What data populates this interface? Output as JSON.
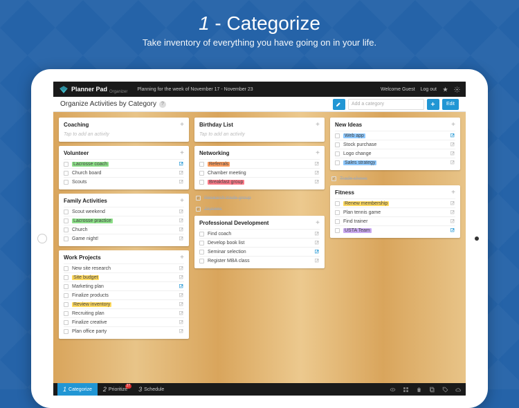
{
  "hero": {
    "number": "1",
    "title": "Categorize",
    "subtitle": "Take inventory of everything you have going on in your life."
  },
  "header": {
    "brand": "Planner Pad",
    "brand_sub": "Organizer",
    "week_label": "Planning for the week of November 17 - November 23",
    "welcome": "Welcome Guest",
    "logout": "Log out"
  },
  "titlebar": {
    "title": "Organize Activities by Category",
    "add_placeholder": "Add a category",
    "edit_label": "Edit"
  },
  "columns": [
    [
      {
        "title": "Coaching",
        "placeholder": "Tap to add an activity",
        "rows": []
      },
      {
        "title": "Volunteer",
        "rows": [
          {
            "label": "Lacrosse coach",
            "hl": "g",
            "ext": "blue"
          },
          {
            "label": "Church board",
            "ext": "gray"
          },
          {
            "label": "Scouts",
            "ext": "gray"
          }
        ]
      },
      {
        "title": "Family Activities",
        "rows": [
          {
            "label": "Scout weekend",
            "ext": "gray"
          },
          {
            "label": "Lacrosse practice",
            "hl": "g",
            "ext": "gray"
          },
          {
            "label": "Church",
            "ext": "gray"
          },
          {
            "label": "Game night!",
            "ext": "gray"
          }
        ]
      },
      {
        "title": "Work Projects",
        "rows": [
          {
            "label": "New site research",
            "ext": "gray"
          },
          {
            "label": "Site budget",
            "hl": "y",
            "ext": "gray"
          },
          {
            "label": "Marketing plan",
            "ext": "blue"
          },
          {
            "label": "Finalize products",
            "ext": "gray"
          },
          {
            "label": "Review inventory",
            "hl": "y",
            "ext": "gray"
          },
          {
            "label": "Recruiting plan",
            "ext": "gray"
          },
          {
            "label": "Finalize creative",
            "ext": "gray"
          },
          {
            "label": "Plan office party",
            "ext": "gray"
          }
        ]
      }
    ],
    [
      {
        "title": "Birthday List",
        "placeholder": "Tap to add an activity",
        "rows": []
      },
      {
        "title": "Networking",
        "rows": [
          {
            "label": "Referrals",
            "hl": "o",
            "ext": "gray"
          },
          {
            "label": "Chamber meeting",
            "ext": "gray"
          },
          {
            "label": "Breakfast group",
            "hl": "r",
            "ext": "gray"
          }
        ],
        "extras": [
          {
            "label": "Research trade group",
            "done": true
          },
          {
            "label": "Jaycees",
            "done": true
          }
        ]
      },
      {
        "title": "Professional Development",
        "rows": [
          {
            "label": "Find coach",
            "ext": "gray"
          },
          {
            "label": "Develop book list",
            "ext": "gray"
          },
          {
            "label": "Seminar selection",
            "ext": "blue"
          },
          {
            "label": "Register MBA class",
            "ext": "gray"
          }
        ]
      }
    ],
    [
      {
        "title": "New Ideas",
        "rows": [
          {
            "label": "Web app",
            "hl": "b",
            "ext": "blue"
          },
          {
            "label": "Stock purchase",
            "ext": "gray"
          },
          {
            "label": "Logo change",
            "ext": "gray"
          },
          {
            "label": "Sales strategy",
            "hl": "b",
            "ext": "gray"
          }
        ],
        "extras": [
          {
            "label": "Trade shows",
            "done": true
          }
        ]
      },
      {
        "title": "Fitness",
        "rows": [
          {
            "label": "Renew membership",
            "hl": "y",
            "ext": "gray"
          },
          {
            "label": "Plan tennis game",
            "ext": "gray"
          },
          {
            "label": "Find trainer",
            "ext": "gray"
          },
          {
            "label": "USTA Team",
            "hl": "p",
            "ext": "blue"
          }
        ]
      }
    ]
  ],
  "bottombar": {
    "tabs": [
      {
        "num": "1",
        "label": "Categorize",
        "active": true
      },
      {
        "num": "2",
        "label": "Prioritize",
        "badge": "27"
      },
      {
        "num": "3",
        "label": "Schedule"
      }
    ]
  }
}
